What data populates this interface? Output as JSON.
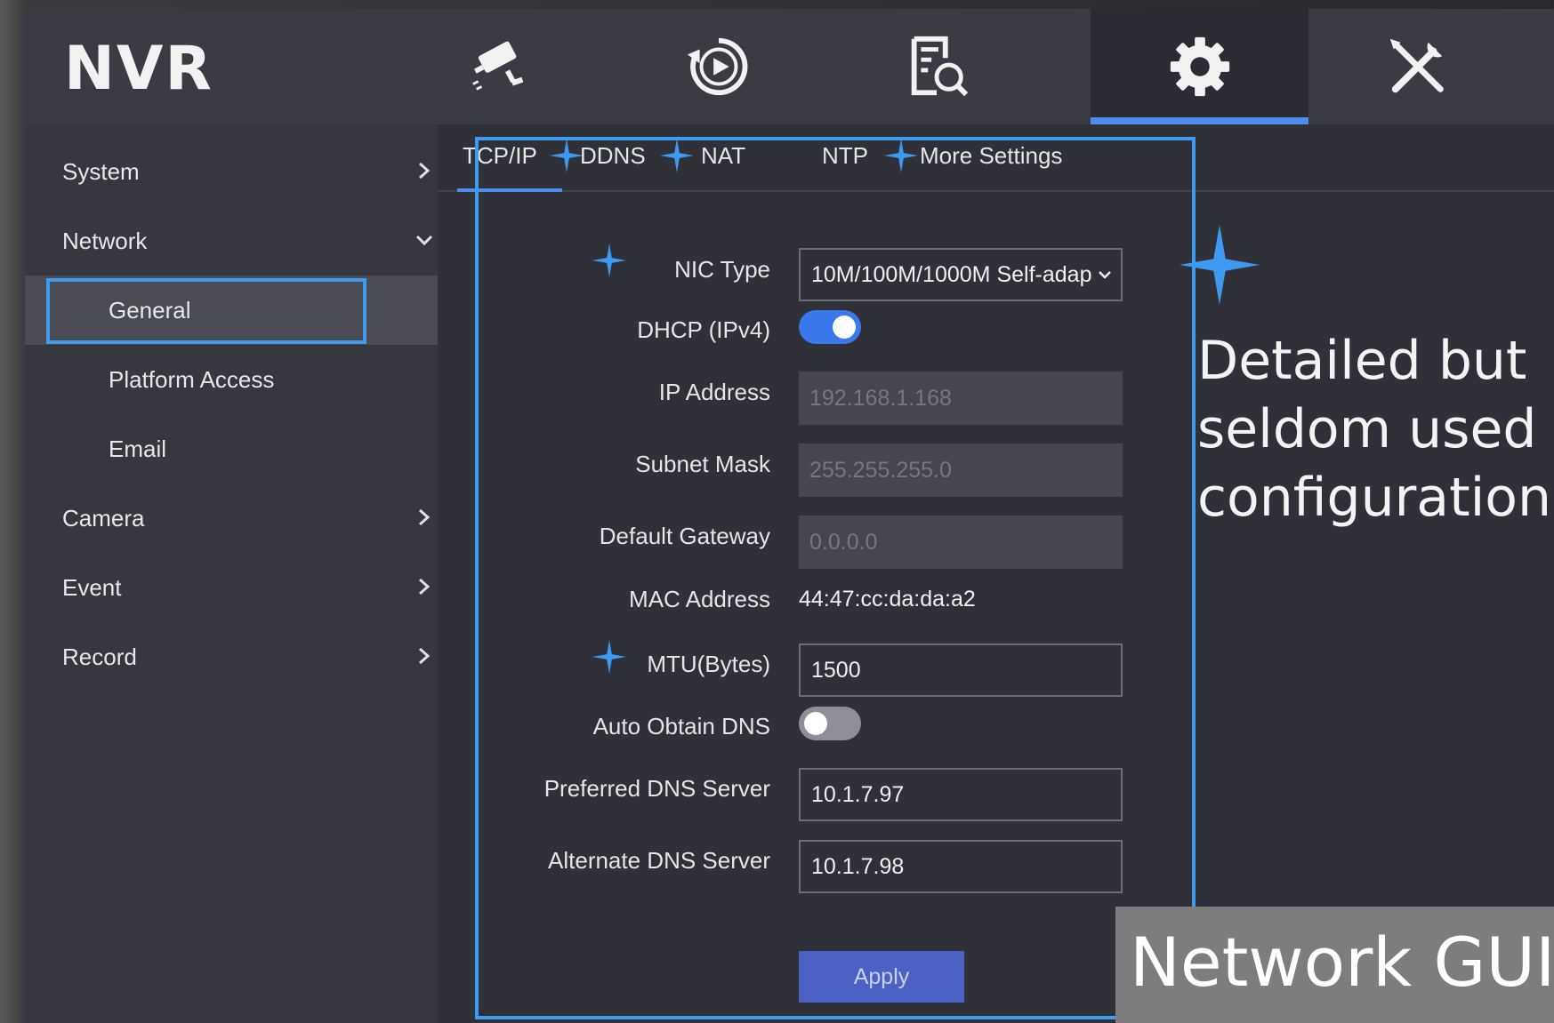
{
  "app": {
    "logo": "NVR"
  },
  "topnav": [
    {
      "icon": "camera-icon"
    },
    {
      "icon": "playback-icon"
    },
    {
      "icon": "search-file-icon"
    },
    {
      "icon": "settings-gear-icon",
      "active": true
    },
    {
      "icon": "tools-icon"
    }
  ],
  "sidebar": {
    "items": [
      {
        "label": "System",
        "chevron": "right"
      },
      {
        "label": "Network",
        "chevron": "down"
      },
      {
        "label": "General",
        "sub": true,
        "active": true
      },
      {
        "label": "Platform Access",
        "sub": true
      },
      {
        "label": "Email",
        "sub": true
      },
      {
        "label": "Camera",
        "chevron": "right"
      },
      {
        "label": "Event",
        "chevron": "right"
      },
      {
        "label": "Record",
        "chevron": "right"
      }
    ]
  },
  "tabs": [
    {
      "label": "TCP/IP",
      "active": true
    },
    {
      "label": "DDNS"
    },
    {
      "label": "NAT"
    },
    {
      "label": "NTP"
    },
    {
      "label": "More Settings"
    }
  ],
  "form": {
    "nic_type": {
      "label": "NIC Type",
      "value": "10M/100M/1000M Self-adap"
    },
    "dhcp": {
      "label": "DHCP (IPv4)",
      "on": true
    },
    "ip_address": {
      "label": "IP Address",
      "value": "192.168.1.168"
    },
    "subnet_mask": {
      "label": "Subnet Mask",
      "value": "255.255.255.0"
    },
    "default_gateway": {
      "label": "Default Gateway",
      "value": "0.0.0.0"
    },
    "mac_address": {
      "label": "MAC Address",
      "value": "44:47:cc:da:da:a2"
    },
    "mtu": {
      "label": "MTU(Bytes)",
      "value": "1500"
    },
    "auto_dns": {
      "label": "Auto Obtain DNS",
      "on": false
    },
    "preferred_dns": {
      "label": "Preferred DNS Server",
      "value": "10.1.7.97"
    },
    "alternate_dns": {
      "label": "Alternate DNS Server",
      "value": "10.1.7.98"
    },
    "apply_label": "Apply"
  },
  "annotations": {
    "note_lines": [
      "Detailed but",
      "seldom used",
      "configurations"
    ],
    "caption": "Network GUI"
  },
  "colors": {
    "accent": "#3d9af0",
    "toggle_on": "#3a78ee",
    "apply": "#4a62c4"
  }
}
